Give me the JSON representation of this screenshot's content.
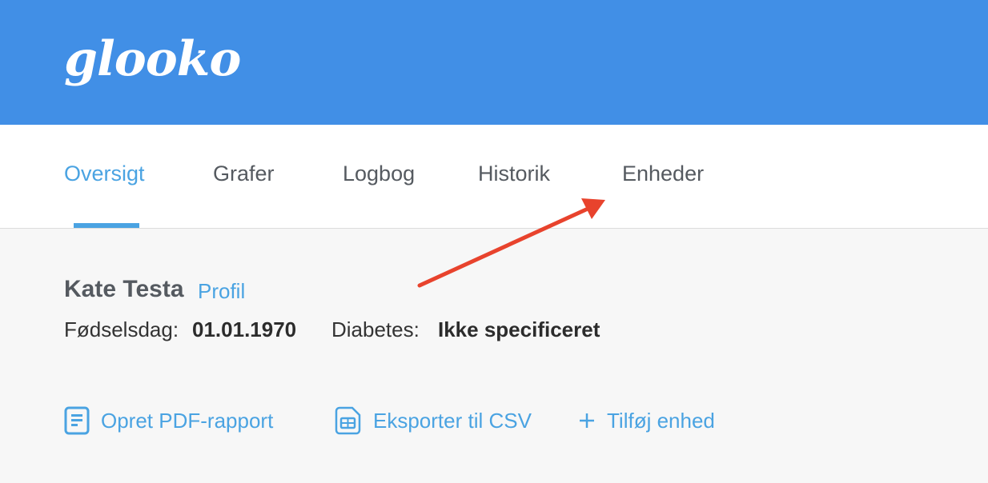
{
  "app": {
    "logo_text": "glooko",
    "brand_color": "#418fe6",
    "accent_color": "#4aa3e2",
    "annotation_color": "#e8432d"
  },
  "tabs": [
    {
      "label": "Oversigt",
      "active": true
    },
    {
      "label": "Grafer",
      "active": false
    },
    {
      "label": "Logbog",
      "active": false
    },
    {
      "label": "Historik",
      "active": false
    },
    {
      "label": "Enheder",
      "active": false
    }
  ],
  "patient": {
    "name": "Kate Testa",
    "profile_link": "Profil",
    "birthday_label": "Fødselsdag:",
    "birthday_value": "01.01.1970",
    "diabetes_label": "Diabetes:",
    "diabetes_value": "Ikke specificeret"
  },
  "actions": [
    {
      "label": "Opret PDF-rapport",
      "icon": "document-icon"
    },
    {
      "label": "Eksporter til CSV",
      "icon": "spreadsheet-icon"
    },
    {
      "label": "Tilføj enhed",
      "icon": "plus-icon"
    }
  ]
}
